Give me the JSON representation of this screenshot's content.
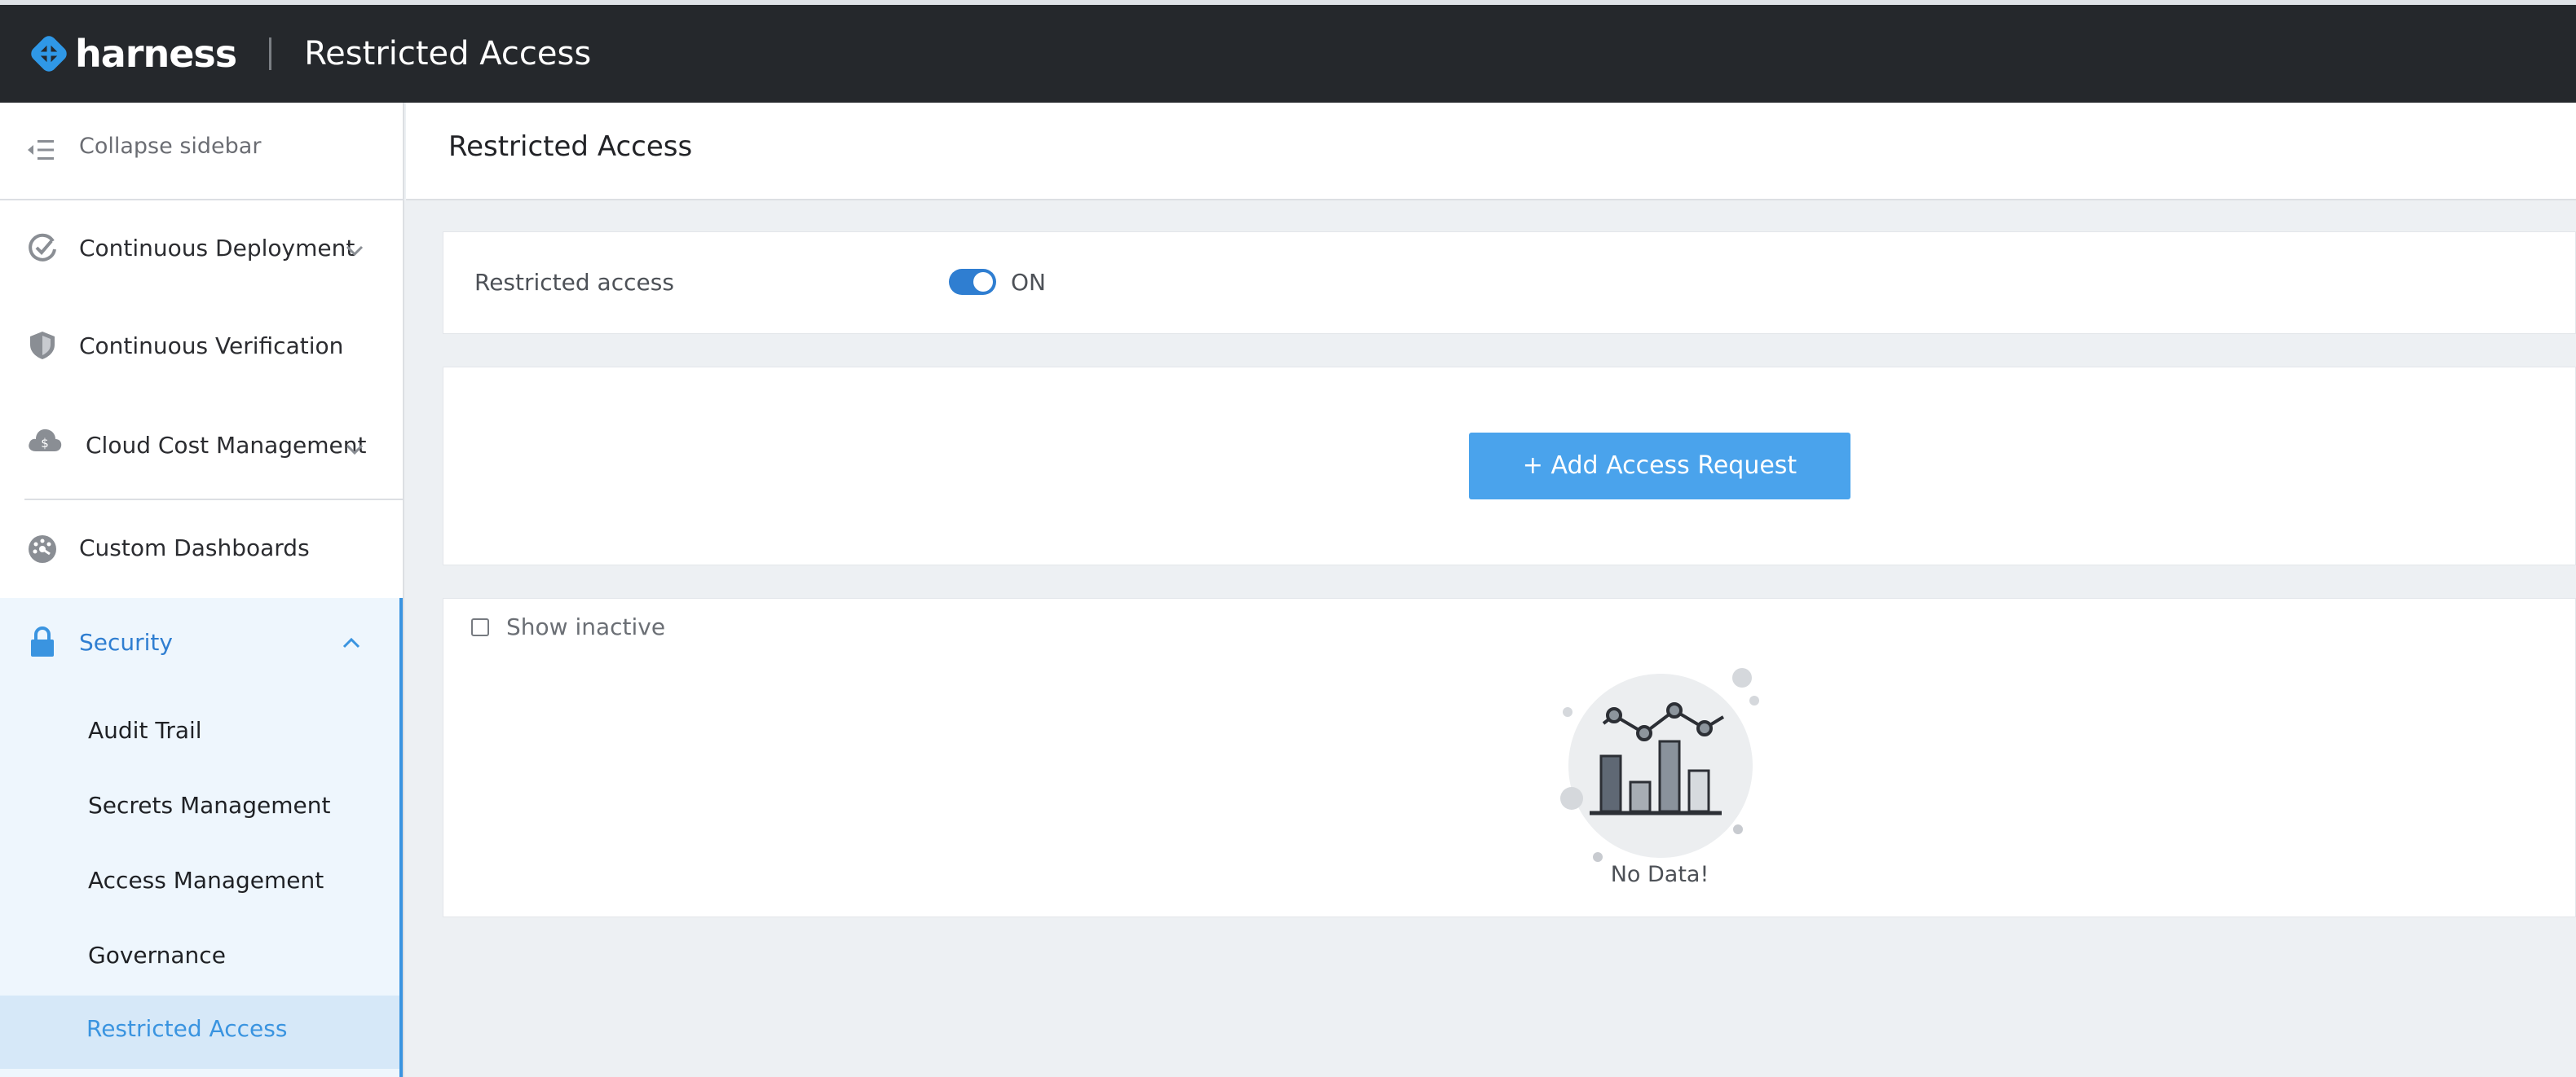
{
  "topbar": {
    "brand": "harness",
    "title": "Restricted Access"
  },
  "sidebar": {
    "collapse_label": "Collapse sidebar",
    "items": [
      {
        "label": "Continuous Deployment",
        "icon": "deployment-icon",
        "expandable": true
      },
      {
        "label": "Continuous Verification",
        "icon": "shield-icon",
        "expandable": false
      },
      {
        "label": "Cloud Cost Management",
        "icon": "cloud-cost-icon",
        "expandable": true
      },
      {
        "label": "Custom Dashboards",
        "icon": "dashboard-icon",
        "expandable": false
      },
      {
        "label": "Security",
        "icon": "lock-icon",
        "expandable": true,
        "expanded": true
      }
    ],
    "security_subitems": [
      {
        "label": "Audit Trail"
      },
      {
        "label": "Secrets Management"
      },
      {
        "label": "Access Management"
      },
      {
        "label": "Governance"
      },
      {
        "label": "Restricted Access",
        "active": true
      }
    ]
  },
  "main": {
    "title": "Restricted Access",
    "restricted_access": {
      "label": "Restricted access",
      "toggle_state": "ON",
      "enabled": true
    },
    "add_button_label": "+ Add Access Request",
    "show_inactive_label": "Show inactive",
    "show_inactive_checked": false,
    "empty_state_text": "No Data!"
  },
  "colors": {
    "topbar_bg": "#25282c",
    "accent": "#3a94e0",
    "button": "#4aa3ec",
    "toggle_on": "#2f7ed1",
    "active_item_bg": "#d6e8f8",
    "security_bg": "#eef6fd"
  }
}
